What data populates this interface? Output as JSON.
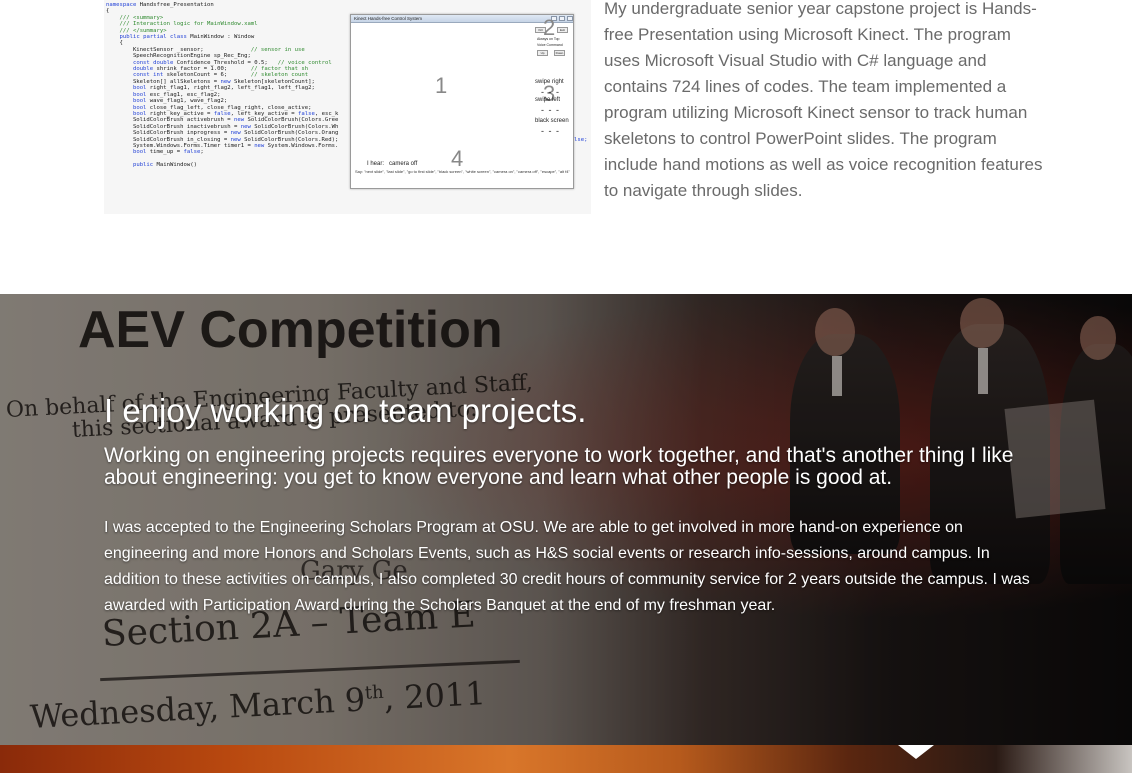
{
  "intro": {
    "paragraph": "My undergraduate senior year capstone project is Hands-free Presentation using Microsoft Kinect. The program uses Microsoft Visual Studio with C# language and contains 724 lines of codes. The team implemented a program utilizing Microsoft Kinect sensor to track human skeletons to control PowerPoint slides. The program include hand motions as well as voice recognition features to navigate through slides."
  },
  "code_screenshot": {
    "lines": [
      "namespace Handsfree_Presentation",
      "{",
      "    /// <summary>",
      "    /// Interaction logic for MainWindow.xaml",
      "    /// </summary>",
      "    public partial class MainWindow : Window",
      "    {",
      "        KinectSensor _sensor;              // sensor in use",
      "        SpeechRecognitionEngine sp_Rec_Eng;",
      "        const double Confidence_Threshold = 0.5;   // voice control",
      "        double shrink_factor = 1.00;       // factor that sh",
      "        const int skeletonCount = 6;       // skeleton count",
      "        Skeleton[] allSkeletons = new Skeleton[skeletonCount];",
      "        bool right_flag1, right_flag2, left_flag1, left_flag2;",
      "        bool esc_flag1, esc_flag2;",
      "        bool wave_flag1, wave_flag2;",
      "        bool close_flag_left, close_flag_right, close_active;",
      "        bool right_key_active = false, left_key_active = false, esc_k",
      "        SolidColorBrush activebrush = new SolidColorBrush(Colors.Gree",
      "        SolidColorBrush inactivebrush = new SolidColorBrush(Colors.Wh",
      "        SolidColorBrush inprogress = new SolidColorBrush(Colors.Orang",
      "        SolidColorBrush in_closing = new SolidColorBrush(Colors.Red);",
      "        System.Windows.Forms.Timer timer1 = new System.Windows.Forms.",
      "        bool time_up = false;",
      "",
      "        public MainWindow()"
    ],
    "kinect_window": {
      "title": "Kinect Hands-free Control System",
      "num_1": "1",
      "num_2": "2",
      "num_3": "3",
      "num_4": "4",
      "swipe_right": "swipe right",
      "swipe_left": "swipe left",
      "black_screen": "black screen",
      "dashes": "- - -",
      "i_hear": "I hear:",
      "heard_value": "camera off",
      "say_hint": "Say:     \"next slide\", \"last slide\", \"go to first slide\", \"black screen\", \"white screen\", \"camera on\", \"camera off\", \"escape\", \"alt f4\"",
      "btn_a": "Kill",
      "btn_b": "Exit",
      "btn_c": "Up",
      "btn_d": "Down",
      "check_a": "Always on Top",
      "check_b": "Voice Command",
      "overflow_text": "lse;"
    }
  },
  "hero": {
    "title": "I enjoy working on team projects.",
    "subtitle": "Working on engineering projects requires everyone to work together, and that's another thing I like about engineering: you get to know everyone and learn what other people is good at.",
    "body": "I was accepted to the Engineering Scholars Program at OSU. We are able to get involved in more hand-on experience on engineering and more Honors and Scholars Events, such as H&S social events or research info-sessions, around campus. In addition to these activities on campus, I also completed 30 credit hours of community service for 2 years outside the campus. I was awarded with Participation Award during the Scholars Banquet at the end of my freshman year."
  },
  "hero_background_photo": {
    "aev": "AEV Competition",
    "on_behalf": "On behalf of the Engineering Faculty and Staff,",
    "sectional": "this sectional award is presented to:",
    "name": "Gary Ge",
    "section": "Section 2A – Team E",
    "date_prefix": "Wednesday, March 9",
    "date_sup": "th",
    "date_year": ", 2011"
  }
}
